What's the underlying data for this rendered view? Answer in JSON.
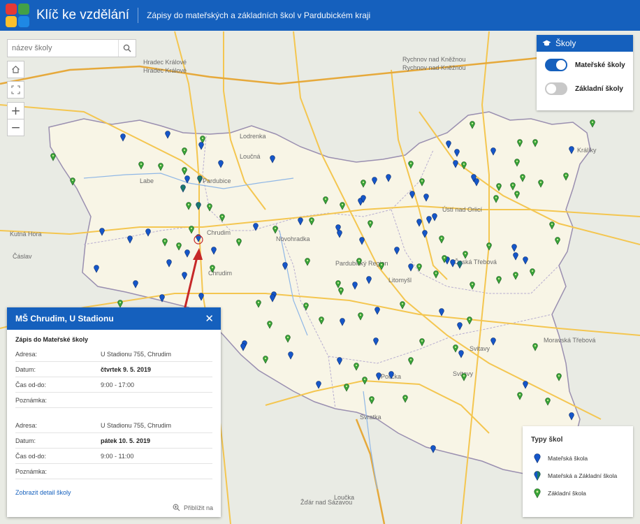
{
  "header": {
    "title": "Klíč ke vzdělání",
    "subtitle": "Zápisy do mateřských a základních škol v Pardubickém kraji",
    "logo_colors": [
      "#e53935",
      "#43a047",
      "#fbc02d",
      "#1e88e5"
    ]
  },
  "search": {
    "placeholder": "název školy"
  },
  "map_controls": {
    "home": "⌂",
    "extent": "⤢",
    "zoom_in": "+",
    "zoom_out": "−"
  },
  "layers": {
    "title": "Školy",
    "items": [
      {
        "label": "Mateřské školy",
        "on": true
      },
      {
        "label": "Základní školy",
        "on": false
      }
    ]
  },
  "popup": {
    "title": "MŠ Chrudim, U Stadionu",
    "section": "Zápis do Mateřské školy",
    "records": [
      {
        "adresa_label": "Adresa:",
        "adresa": "U Stadionu 755, Chrudim",
        "datum_label": "Datum:",
        "datum": "čtvrtek 9. 5. 2019",
        "cas_label": "Čas od-do:",
        "cas": "9:00 - 17:00",
        "poznamka_label": "Poznámka:"
      },
      {
        "adresa_label": "Adresa:",
        "adresa": "U Stadionu 755, Chrudim",
        "datum_label": "Datum:",
        "datum": "pátek 10. 5. 2019",
        "cas_label": "Čas od-do:",
        "cas": "9:00 - 11:00",
        "poznamka_label": "Poznámka:"
      }
    ],
    "detail_link": "Zobrazit detail školy",
    "zoom_to": "Přiblížit na"
  },
  "legend": {
    "title": "Typy škol",
    "items": [
      {
        "label": "Mateřská škola",
        "color": "#1556c9"
      },
      {
        "label": "Mateřská a Základní škola",
        "color": "#1a7a6a"
      },
      {
        "label": "Základní škola",
        "color": "#3aa53a"
      }
    ]
  },
  "map": {
    "place_labels": [
      "Hradec Králové",
      "Hradec Králové",
      "Rychnov nad Kněžnou",
      "Rychnov nad Kněžnou",
      "Pardubice",
      "Chrudim",
      "Chrudim",
      "Pardubický Region",
      "Litomyšl",
      "Ústí nad Orlicí",
      "Česká Třebová",
      "Svitavy",
      "Svitavy",
      "Moravská Třebová",
      "Polička",
      "Králíky",
      "Žďár nad Sázavou",
      "Čáslav",
      "Kutná Hora",
      "Labe",
      "Loučná",
      "Novohradka",
      "Svratka",
      "Loučka",
      "Lodrenka"
    ],
    "pin_colors": {
      "ms": "#1556c9",
      "msz": "#1a7a6a",
      "zs": "#3aa53a"
    },
    "region_fill": "#f8f5e6",
    "outside_fill": "#e9ebe4"
  }
}
